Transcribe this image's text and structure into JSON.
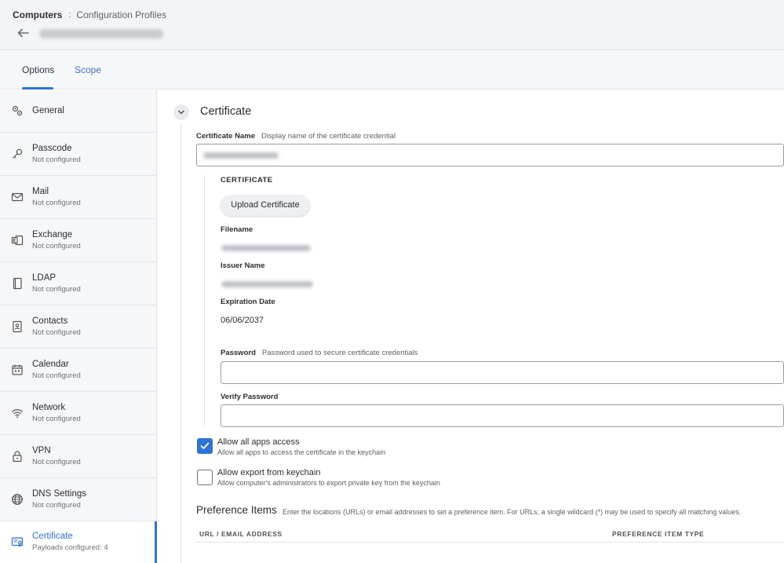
{
  "header": {
    "breadcrumb_root": "Computers",
    "breadcrumb_separator": ":",
    "breadcrumb_current": "Configuration Profiles"
  },
  "tabs": [
    {
      "label": "Options",
      "active": true
    },
    {
      "label": "Scope",
      "active": false
    }
  ],
  "sidebar": {
    "items": [
      {
        "label": "General",
        "status": "",
        "icon": "gears-icon"
      },
      {
        "label": "Passcode",
        "status": "Not configured",
        "icon": "key-icon"
      },
      {
        "label": "Mail",
        "status": "Not configured",
        "icon": "envelope-icon"
      },
      {
        "label": "Exchange",
        "status": "Not configured",
        "icon": "exchange-icon"
      },
      {
        "label": "LDAP",
        "status": "Not configured",
        "icon": "book-icon"
      },
      {
        "label": "Contacts",
        "status": "Not configured",
        "icon": "contact-card-icon"
      },
      {
        "label": "Calendar",
        "status": "Not configured",
        "icon": "calendar-icon"
      },
      {
        "label": "Network",
        "status": "Not configured",
        "icon": "wifi-icon"
      },
      {
        "label": "VPN",
        "status": "Not configured",
        "icon": "lock-icon"
      },
      {
        "label": "DNS Settings",
        "status": "Not configured",
        "icon": "globe-icon"
      },
      {
        "label": "Certificate",
        "status": "Payloads configured: 4",
        "icon": "certificate-icon",
        "active": true
      }
    ]
  },
  "certificate": {
    "section_title": "Certificate",
    "name_label": "Certificate Name",
    "name_hint": "Display name of the certificate credential",
    "cert_heading": "CERTIFICATE",
    "upload_button": "Upload Certificate",
    "filename_label": "Filename",
    "issuer_label": "Issuer Name",
    "expiration_label": "Expiration Date",
    "expiration_value": "06/06/2037",
    "password_label": "Password",
    "password_hint": "Password used to secure certificate credentials",
    "verify_password_label": "Verify Password",
    "allow_all_apps": {
      "label": "Allow all apps access",
      "description": "Allow all apps to access the certificate in the keychain",
      "checked": true
    },
    "allow_export": {
      "label": "Allow export from keychain",
      "description": "Allow computer's administrators to export private key from the keychain",
      "checked": false
    }
  },
  "preference_items": {
    "title": "Preference Items",
    "hint": "Enter the locations (URLs) or email addresses to set a preference item. For URLs, a single wildcard (*) may be used to specify all matching values.",
    "columns": [
      "URL / EMAIL ADDRESS",
      "PREFERENCE ITEM TYPE"
    ]
  },
  "colors": {
    "accent": "#2f73d6",
    "sidebar_bg": "#f6f7f8",
    "header_bg": "#f3f4f6"
  }
}
